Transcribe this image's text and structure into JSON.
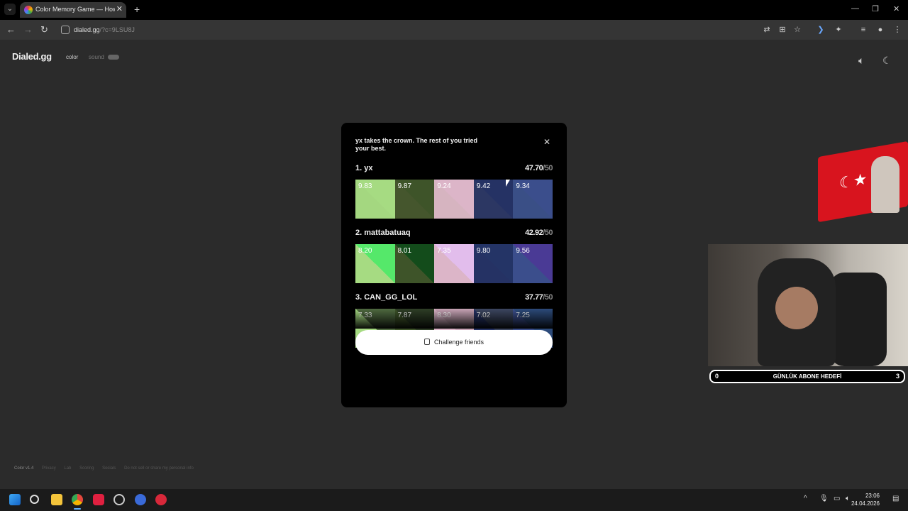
{
  "browser": {
    "tab_title": "Color Memory Game — How W",
    "url_host": "dialed.gg",
    "url_path": "/?c=9LSU8J"
  },
  "site": {
    "logo": "Dialed.gg",
    "nav_color": "color",
    "nav_sound": "sound",
    "footer": [
      "Color v1.4",
      "Privacy",
      "Lab",
      "Scoring",
      "Socials",
      "Do not sell or share my personal info"
    ]
  },
  "modal": {
    "heading": "yx takes the crown. The rest of you tried your best.",
    "close": "×",
    "cta_label": "Challenge friends",
    "players": [
      {
        "rank_name": "1. yx",
        "score": "47.70",
        "max": "/50",
        "swatches": [
          {
            "value": "9.83",
            "target": "#a6db82",
            "guess": "#a4d780"
          },
          {
            "value": "9.87",
            "target": "#3e5429",
            "guess": "#45562d"
          },
          {
            "value": "9.24",
            "target": "#dcb5c8",
            "guess": "#d6b4c0"
          },
          {
            "value": "9.42",
            "target": "#253264",
            "guess": "#2c3763"
          },
          {
            "value": "9.34",
            "target": "#3b4e8c",
            "guess": "#3a4f86"
          }
        ]
      },
      {
        "rank_name": "2. mattabatuaq",
        "score": "42.92",
        "max": "/50",
        "swatches": [
          {
            "value": "8.20",
            "target": "#55e86a",
            "guess": "#a6db82"
          },
          {
            "value": "8.01",
            "target": "#134c1b",
            "guess": "#3e5429"
          },
          {
            "value": "7.35",
            "target": "#e2bdec",
            "guess": "#dcb5c8"
          },
          {
            "value": "9.80",
            "target": "#243466",
            "guess": "#253264"
          },
          {
            "value": "9.56",
            "target": "#4a3a95",
            "guess": "#3b4e8c"
          }
        ]
      },
      {
        "rank_name": "3. CAN_GG_LOL",
        "score": "37.77",
        "max": "/50",
        "swatches": [
          {
            "value": "7.33",
            "target": "#4f6a40",
            "guess": "#a6db82"
          },
          {
            "value": "7.87",
            "target": "#2e3e26",
            "guess": "#3e5429"
          },
          {
            "value": "8.30",
            "target": "#c8a4b6",
            "guess": "#dcb5c8"
          },
          {
            "value": "7.02",
            "target": "#3c4660",
            "guess": "#253264"
          },
          {
            "value": "7.25",
            "target": "#2c4a7a",
            "guess": "#3b4e8c"
          }
        ]
      }
    ]
  },
  "stream": {
    "sub_left": "0",
    "sub_title": "GÜNLÜK ABONE HEDEFİ",
    "sub_right": "3"
  },
  "taskbar": {
    "time": "23:06",
    "date": "24.04.2026"
  }
}
